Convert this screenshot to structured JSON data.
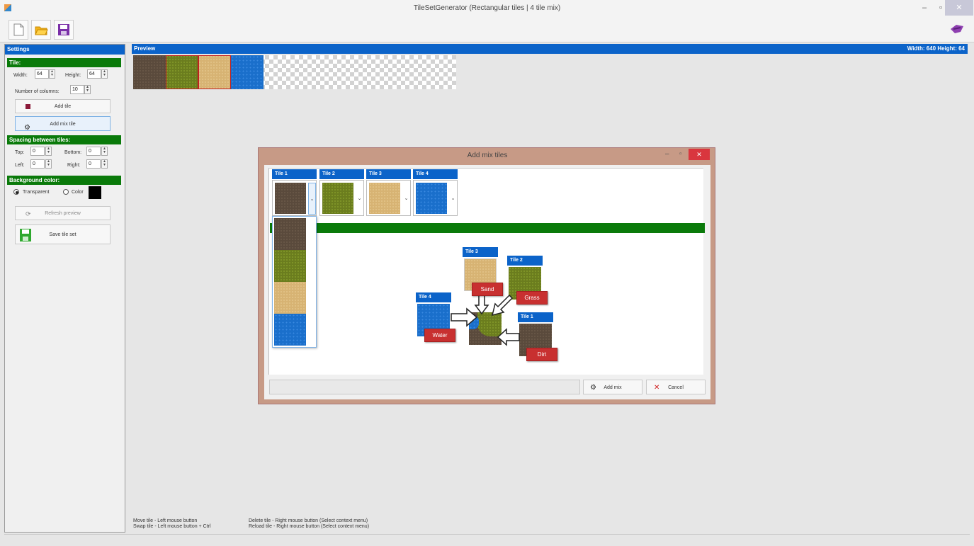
{
  "window": {
    "title": "TileSetGenerator (Rectangular tiles | 4 tile mix)",
    "minimize": "–",
    "maximize": "▫",
    "close": "✕"
  },
  "toolbar": {
    "new_icon": "new-file-icon",
    "open_icon": "open-folder-icon",
    "save_icon": "save-disk-icon",
    "right_icon": "paint-brush-icon"
  },
  "settings": {
    "header": "Settings",
    "tile_group": "Tile:",
    "width_label": "Width:",
    "width_value": "64",
    "height_label": "Height:",
    "height_value": "64",
    "columns_label": "Number of columns:",
    "columns_value": "10",
    "add_tile": "Add tile",
    "add_mix_tile": "Add mix tile",
    "spacing_group": "Spacing between tiles:",
    "top_label": "Top:",
    "top_value": "0",
    "bottom_label": "Bottom:",
    "bottom_value": "0",
    "left_label": "Left:",
    "left_value": "0",
    "right_label": "Right:",
    "right_value": "0",
    "bg_group": "Background color:",
    "transparent_label": "Transparent",
    "color_label": "Color",
    "bg_color": "#000000",
    "refresh": "Refresh preview",
    "save_tileset": "Save tile set"
  },
  "preview": {
    "header": "Preview",
    "size_info": "Width: 640  Height: 64",
    "tiles": [
      "dirt",
      "grass",
      "sand",
      "water"
    ]
  },
  "status": {
    "move": "Move tile - Left mouse button",
    "swap": "Swap tile - Left mouse button + Ctrl",
    "delete": "Delete tile - Right mouse button (Select context menu)",
    "reload": "Reload tile - Right mouse button (Select context menu)"
  },
  "dialog": {
    "title": "Add mix tiles",
    "minimize": "–",
    "maximize": "▫",
    "close": "✕",
    "tabs": [
      "Tile 1",
      "Tile 2",
      "Tile 3",
      "Tile 4"
    ],
    "diagram": {
      "tile3": "Tile 3",
      "tile2": "Tile 2",
      "tile4": "Tile 4",
      "tile1": "Tile 1",
      "sand": "Sand",
      "grass": "Grass",
      "water": "Water",
      "dirt": "Dirt"
    },
    "add_mix": "Add mix",
    "cancel": "Cancel",
    "colors": {
      "dirt": "#5a4a3c",
      "grass": "#6b7d1e",
      "sand": "#d7b373",
      "water": "#1a6fcb"
    }
  }
}
